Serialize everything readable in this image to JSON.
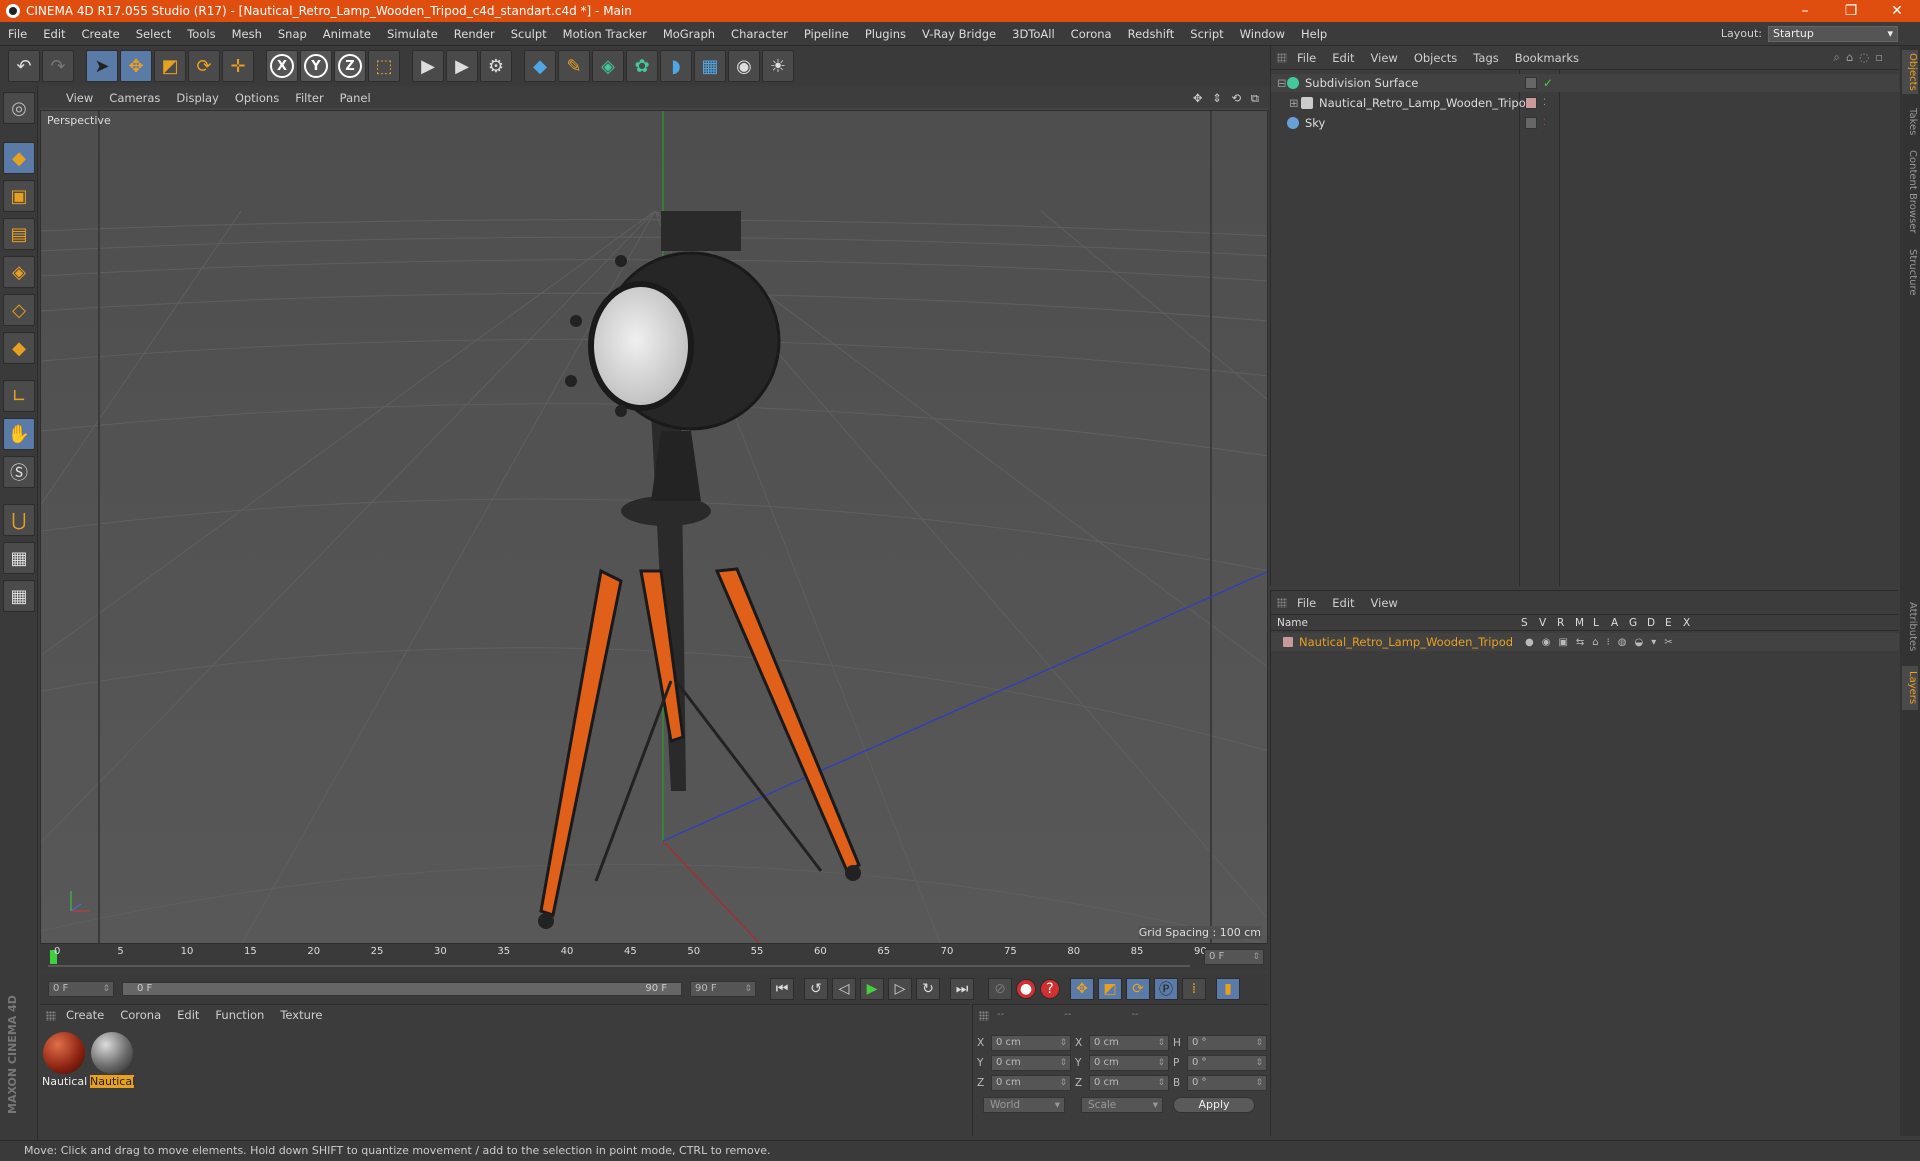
{
  "window": {
    "title": "CINEMA 4D R17.055 Studio (R17) - [Nautical_Retro_Lamp_Wooden_Tripod_c4d_standart.c4d *] - Main",
    "controls": [
      "–",
      "❐",
      "✕"
    ]
  },
  "menubar": {
    "items": [
      "File",
      "Edit",
      "Create",
      "Select",
      "Tools",
      "Mesh",
      "Snap",
      "Animate",
      "Simulate",
      "Render",
      "Sculpt",
      "Motion Tracker",
      "MoGraph",
      "Character",
      "Pipeline",
      "Plugins",
      "V-Ray Bridge",
      "3DToAll",
      "Corona",
      "Redshift",
      "Script",
      "Window",
      "Help"
    ],
    "layout_label": "Layout:",
    "layout_value": "Startup"
  },
  "toolbar": {
    "icons": [
      "undo-icon",
      "redo-icon",
      "select-icon",
      "move-icon",
      "scale-icon",
      "rotate-icon",
      "add-icon",
      "x-axis-icon",
      "y-axis-icon",
      "z-axis-icon",
      "coord-system-icon",
      "render-view-icon",
      "render-picture-viewer-icon",
      "edit-render-settings-icon",
      "cube-icon",
      "pen-icon",
      "subdivision-icon",
      "cloner-icon",
      "deformer-icon",
      "floor-icon",
      "camera-icon",
      "light-icon"
    ],
    "axis_labels": [
      "X",
      "Y",
      "Z"
    ]
  },
  "viewport": {
    "menu": [
      "View",
      "Cameras",
      "Display",
      "Options",
      "Filter",
      "Panel"
    ],
    "nav_icons": "✥ ⇕ ⟲ ⧉",
    "camera_label": "Perspective",
    "grid_spacing": "Grid Spacing : 100 cm"
  },
  "timeline": {
    "ticks": [
      "0",
      "5",
      "10",
      "15",
      "20",
      "25",
      "30",
      "35",
      "40",
      "45",
      "50",
      "55",
      "60",
      "65",
      "70",
      "75",
      "80",
      "85",
      "90"
    ],
    "current_frame_field": "0 F",
    "start_field": "0 F",
    "range_start": "0 F",
    "range_end": "90 F",
    "end_field": "90 F"
  },
  "materials": {
    "menu": [
      "Create",
      "Corona",
      "Edit",
      "Function",
      "Texture"
    ],
    "items": [
      {
        "label": "Nautical",
        "selected": false,
        "color": "#b0321a"
      },
      {
        "label": "Nautical",
        "selected": true,
        "color": "#8a8a8a"
      }
    ]
  },
  "coordinates": {
    "headers": [
      "--",
      "--",
      "--"
    ],
    "rows": [
      {
        "a": "X",
        "a_val": "0 cm",
        "b": "X",
        "b_val": "0 cm",
        "c": "H",
        "c_val": "0 °"
      },
      {
        "a": "Y",
        "a_val": "0 cm",
        "b": "Y",
        "b_val": "0 cm",
        "c": "P",
        "c_val": "0 °"
      },
      {
        "a": "Z",
        "a_val": "0 cm",
        "b": "Z",
        "b_val": "0 cm",
        "c": "B",
        "c_val": "0 °"
      }
    ],
    "mode": "World",
    "transform": "Scale",
    "apply": "Apply"
  },
  "objects": {
    "menu": [
      "File",
      "Edit",
      "View",
      "Objects",
      "Tags",
      "Bookmarks"
    ],
    "items": [
      {
        "name": "Subdivision Surface",
        "icon_color": "#42c99a"
      },
      {
        "name": "Nautical_Retro_Lamp_Wooden_Tripod",
        "icon_color": "#cccccc"
      },
      {
        "name": "Sky",
        "icon_color": "#6aa0d8"
      }
    ]
  },
  "layers": {
    "menu": [
      "File",
      "Edit",
      "View"
    ],
    "columns": [
      "Name",
      "S",
      "V",
      "R",
      "M",
      "L",
      "A",
      "G",
      "D",
      "E",
      "X"
    ],
    "rows": [
      {
        "name": "Nautical_Retro_Lamp_Wooden_Tripod"
      }
    ]
  },
  "side_tabs": [
    "Objects",
    "Takes",
    "Content Browser",
    "Structure",
    "Attributes",
    "Layers"
  ],
  "brand": "MAXON CINEMA 4D",
  "status": "Move: Click and drag to move elements. Hold down SHIFT to quantize movement / add to the selection in point mode, CTRL to remove.",
  "colors": {
    "accent": "#e04e0f",
    "highlight": "#e8a020"
  }
}
